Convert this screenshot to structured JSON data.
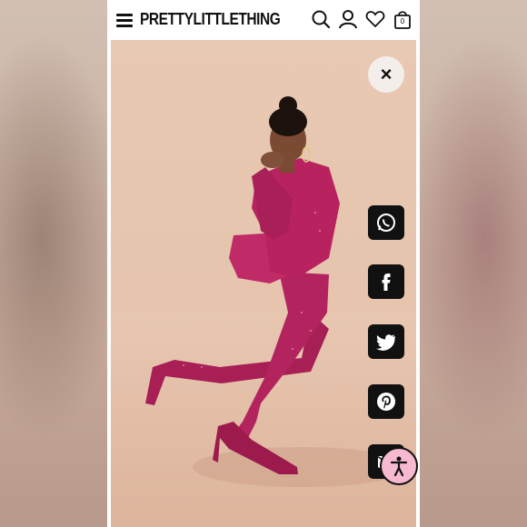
{
  "header": {
    "brand": "PRETTYLITTLETHING",
    "cart_count": "0",
    "icons": [
      "menu-icon",
      "search-icon",
      "account-icon",
      "heart-icon",
      "bag-icon"
    ]
  },
  "gallery": {
    "close_label": "×",
    "share_icons": [
      "whatsapp-icon",
      "facebook-icon",
      "twitter-icon",
      "pinterest-icon",
      "email-icon"
    ],
    "accessibility_icon": "accessibility-icon"
  },
  "colors": {
    "brand_text": "#111111",
    "share_bg": "#111111",
    "accessibility_bg": "#f7b9d0",
    "outfit": "#b3245f",
    "backdrop": "#e8c9b3"
  }
}
